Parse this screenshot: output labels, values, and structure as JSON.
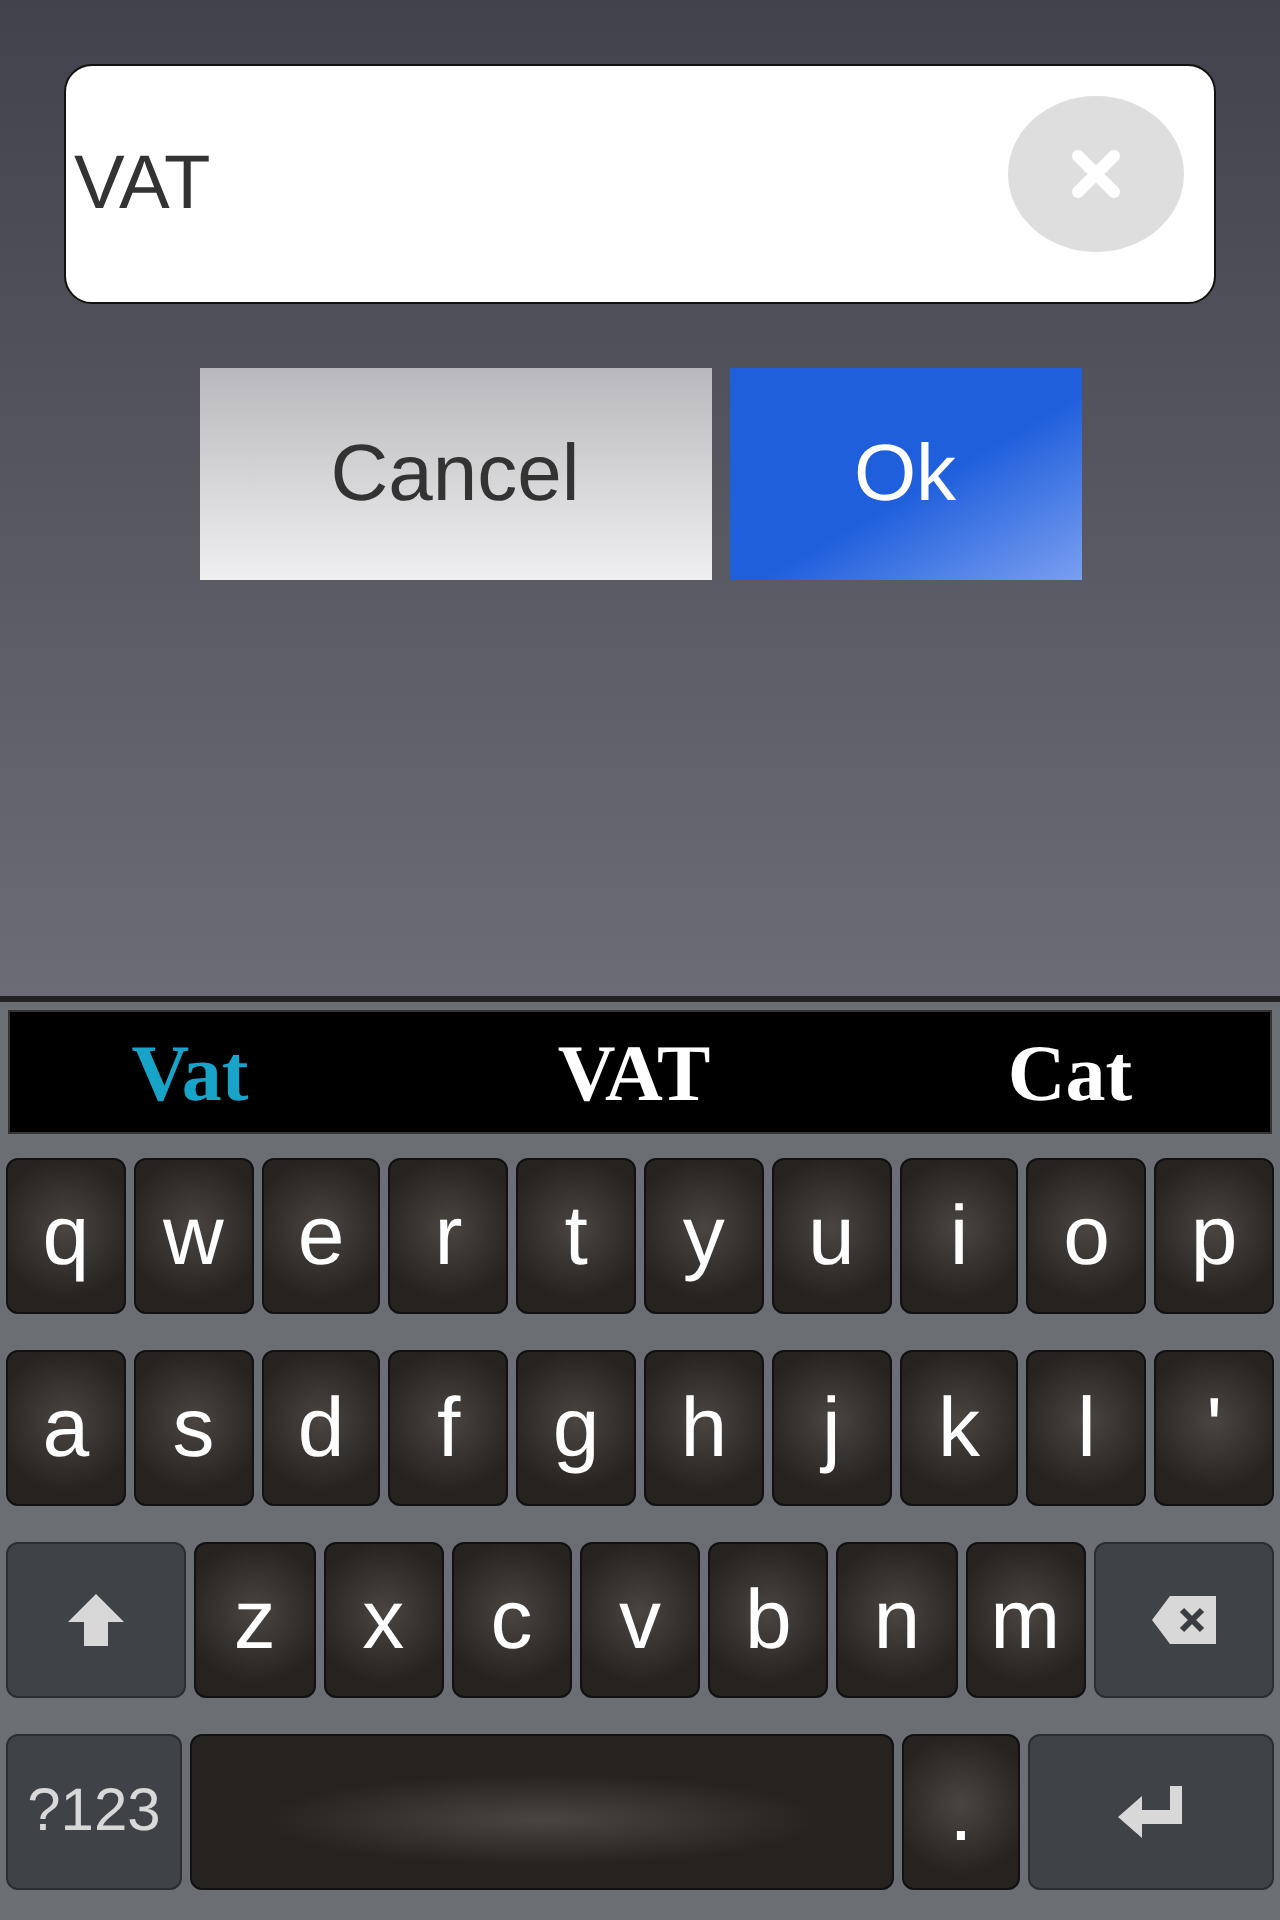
{
  "text_field": {
    "value": "VAT"
  },
  "buttons": [
    {
      "label": "Cancel",
      "kind": "secondary"
    },
    {
      "label": "Ok",
      "kind": "primary"
    }
  ],
  "suggestions": [
    {
      "label": "Vat",
      "selected": true
    },
    {
      "label": "VAT",
      "selected": false
    },
    {
      "label": "Cat",
      "selected": false
    }
  ],
  "keyboard_rows": [
    [
      {
        "kind": "letter",
        "label": "q"
      },
      {
        "kind": "letter",
        "label": "w"
      },
      {
        "kind": "letter",
        "label": "e"
      },
      {
        "kind": "letter",
        "label": "r"
      },
      {
        "kind": "letter",
        "label": "t"
      },
      {
        "kind": "letter",
        "label": "y"
      },
      {
        "kind": "letter",
        "label": "u"
      },
      {
        "kind": "letter",
        "label": "i"
      },
      {
        "kind": "letter",
        "label": "o"
      },
      {
        "kind": "letter",
        "label": "p"
      }
    ],
    [
      {
        "kind": "letter",
        "label": "a"
      },
      {
        "kind": "letter",
        "label": "s"
      },
      {
        "kind": "letter",
        "label": "d"
      },
      {
        "kind": "letter",
        "label": "f"
      },
      {
        "kind": "letter",
        "label": "g"
      },
      {
        "kind": "letter",
        "label": "h"
      },
      {
        "kind": "letter",
        "label": "j"
      },
      {
        "kind": "letter",
        "label": "k"
      },
      {
        "kind": "letter",
        "label": "l"
      },
      {
        "kind": "letter",
        "label": "'"
      }
    ],
    [
      {
        "kind": "shift"
      },
      {
        "kind": "letter",
        "label": "z"
      },
      {
        "kind": "letter",
        "label": "x"
      },
      {
        "kind": "letter",
        "label": "c"
      },
      {
        "kind": "letter",
        "label": "v"
      },
      {
        "kind": "letter",
        "label": "b"
      },
      {
        "kind": "letter",
        "label": "n"
      },
      {
        "kind": "letter",
        "label": "m"
      },
      {
        "kind": "backspace"
      }
    ],
    [
      {
        "kind": "symbols",
        "label": "?123"
      },
      {
        "kind": "space"
      },
      {
        "kind": "letter",
        "label": "."
      },
      {
        "kind": "enter"
      }
    ]
  ]
}
